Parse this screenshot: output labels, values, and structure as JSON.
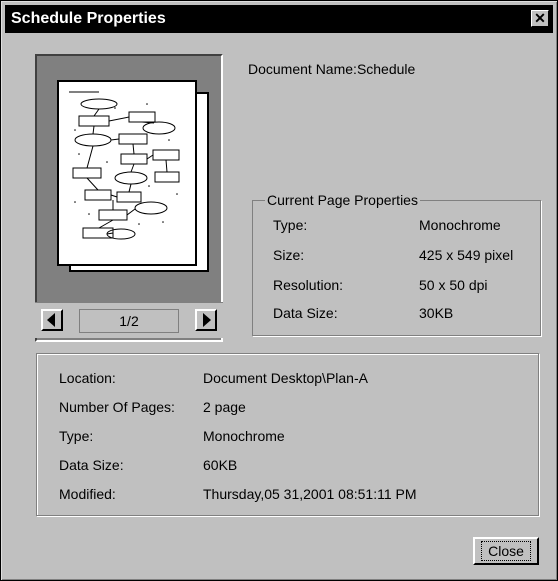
{
  "window": {
    "title": "Schedule Properties",
    "close_glyph": "✕"
  },
  "document": {
    "name_label": "Document Name:",
    "name_value": "Schedule"
  },
  "preview": {
    "page_indicator": "1/2"
  },
  "current_page": {
    "legend": "Current Page Properties",
    "rows": [
      {
        "label": "Type:",
        "value": "Monochrome"
      },
      {
        "label": "Size:",
        "value": "425 x 549 pixel"
      },
      {
        "label": "Resolution:",
        "value": "50 x 50 dpi"
      },
      {
        "label": "Data Size:",
        "value": "30KB"
      }
    ]
  },
  "info": {
    "rows": [
      {
        "label": "Location:",
        "value": "Document Desktop\\Plan-A"
      },
      {
        "label": "Number Of Pages:",
        "value": "2 page"
      },
      {
        "label": "Type:",
        "value": "Monochrome"
      },
      {
        "label": "Data Size:",
        "value": "60KB"
      },
      {
        "label": "Modified:",
        "value": "Thursday,05 31,2001 08:51:11 PM"
      }
    ]
  },
  "buttons": {
    "close": "Close"
  }
}
